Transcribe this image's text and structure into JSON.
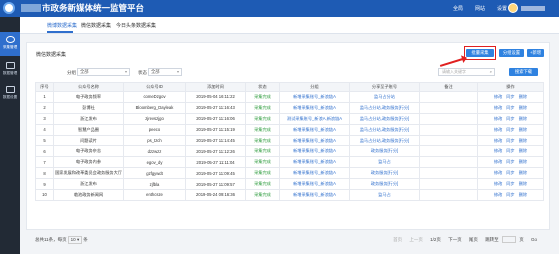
{
  "header": {
    "title": "市政务新媒体统一监管平台",
    "nav": [
      "全局",
      "网站",
      "设置"
    ]
  },
  "sidebar": {
    "items": [
      {
        "label": "采集管理"
      },
      {
        "label": "数据管理"
      },
      {
        "label": "数据设置"
      }
    ]
  },
  "tabs": [
    "微博数据采集",
    "微信数据采集",
    "今日头条数据采集"
  ],
  "panel": {
    "title": "微信数据采集",
    "buttons": {
      "crawl": "批量采集",
      "edit": "分组设置",
      "add": "+新增"
    },
    "filters": {
      "group_label": "分组",
      "group_value": "全部",
      "status_label": "状态",
      "status_value": "全部",
      "search_placeholder": "请输入关键字",
      "search_button": "搜索下载"
    }
  },
  "table": {
    "columns": [
      "序号",
      "公众号名称",
      "公众号ID",
      "添加时间",
      "状态",
      "分组",
      "分享至子账号",
      "备注",
      "操作"
    ],
    "rows": [
      {
        "no": "1",
        "name": "电子政务频率",
        "id": "comeDzgov",
        "time": "2019-05-04 16:11:22",
        "status": "采集完成",
        "group": "新增采集账号_新浪链A",
        "share": "监马占分站",
        "note": "",
        "ops": [
          "修改",
          "同步",
          "删除"
        ]
      },
      {
        "no": "2",
        "name": "彭博社",
        "id": "Bloomberg_Dayleak",
        "time": "2019-05-27 11:16:43",
        "status": "采集完成",
        "group": "新增采集账号_新浪链A",
        "share": "监马占分站,政务服务[行分]",
        "note": "",
        "ops": [
          "修改",
          "同步",
          "删除"
        ]
      },
      {
        "no": "3",
        "name": "浙江发布",
        "id": "zjrevszjgo",
        "time": "2019-05-27 11:16:06",
        "status": "采集完成",
        "group": "测试采集账号_新浪A,新浪链A",
        "share": "监马占分站,政务服务[行分]",
        "note": "",
        "ops": [
          "修改",
          "同步",
          "删除"
        ]
      },
      {
        "no": "4",
        "name": "智慧产品圈",
        "id": "peeco",
        "time": "2019-05-27 11:15:19",
        "status": "采集完成",
        "group": "新增采集账号_新浪链A",
        "share": "监马占分站,政务服务[行分]",
        "note": "",
        "ops": [
          "修改",
          "同步",
          "删除"
        ]
      },
      {
        "no": "5",
        "name": "问题读片",
        "id": "ps_tzch",
        "time": "2019-05-27 11:14:45",
        "status": "采集完成",
        "group": "新增采集账号_新浪链A",
        "share": "监马占分站,政务服务[行分]",
        "note": "",
        "ops": [
          "修改",
          "同步",
          "删除"
        ]
      },
      {
        "no": "6",
        "name": "电子政务杂志",
        "id": "dzzwzz",
        "time": "2019-05-27 11:12:26",
        "status": "采集完成",
        "group": "新增采集账号_新浪链A",
        "share": "政务服务[行分]",
        "note": "",
        "ops": [
          "修改",
          "同步",
          "删除"
        ]
      },
      {
        "no": "7",
        "name": "电子政务内参",
        "id": "egov_dy",
        "time": "2019-05-27 11:11:04",
        "status": "采集完成",
        "group": "新增采集账号_新浪链A",
        "share": "监马占",
        "note": "",
        "ops": [
          "修改",
          "同步",
          "删除"
        ]
      },
      {
        "no": "8",
        "name": "国家发展和改革委员会政务服务大厅",
        "id": "gzfgywdt",
        "time": "2019-05-27 11:09:45",
        "status": "采集完成",
        "group": "新增采集账号_新浪链A",
        "share": "政务服务[行分]",
        "note": "",
        "ops": [
          "修改",
          "同步",
          "删除"
        ]
      },
      {
        "no": "9",
        "name": "浙江发布",
        "id": "zjfbla",
        "time": "2019-05-27 11:09:57",
        "status": "采集完成",
        "group": "新增采集账号_新浪链A",
        "share": "政务服务[行分]",
        "note": "",
        "ops": [
          "修改",
          "同步",
          "删除"
        ]
      },
      {
        "no": "10",
        "name": "临池政务新闻网",
        "id": "enthcsze",
        "time": "2019-05-24 09:16:36",
        "status": "采集完成",
        "group": "新增采集账号_新浪链A",
        "share": "监马占",
        "note": "",
        "ops": [
          "修改",
          "同步",
          "删除"
        ]
      }
    ]
  },
  "pager": {
    "total_prefix": "总共11条，每页",
    "page_size": "10",
    "total_suffix": "条",
    "first": "首页",
    "prev": "上一页",
    "info": "1/2页",
    "next": "下一页",
    "last": "尾页",
    "jump_label": "跳转至",
    "jump_suffix": "页",
    "go": "Go"
  },
  "colors": {
    "brand": "#1e5bb4",
    "accent": "#2f82e0",
    "success": "#2a9a3a",
    "highlight": "#e02020"
  }
}
